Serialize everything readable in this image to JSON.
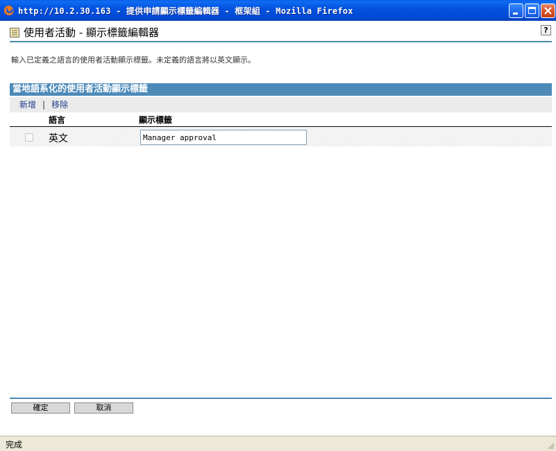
{
  "window": {
    "title": "http://10.2.30.163 - 提供申請顯示標籤編輯器 - 框架組 - Mozilla Firefox"
  },
  "page": {
    "title": "使用者活動 - 顯示標籤編輯器",
    "help": "?",
    "description": "輸入已定義之語言的使用者活動顯示標籤。未定義的語言將以英文顯示。"
  },
  "section": {
    "title": "當地語系化的使用者活動顯示標籤"
  },
  "toolbar": {
    "add_label": "新增",
    "separator": "|",
    "remove_label": "移除"
  },
  "table": {
    "headers": {
      "language": "語言",
      "label": "顯示標籤"
    },
    "rows": [
      {
        "language": "英文",
        "label": "Manager approval",
        "checked": false
      }
    ]
  },
  "buttons": {
    "ok": "確定",
    "cancel": "取消"
  },
  "status": {
    "text": "完成"
  }
}
